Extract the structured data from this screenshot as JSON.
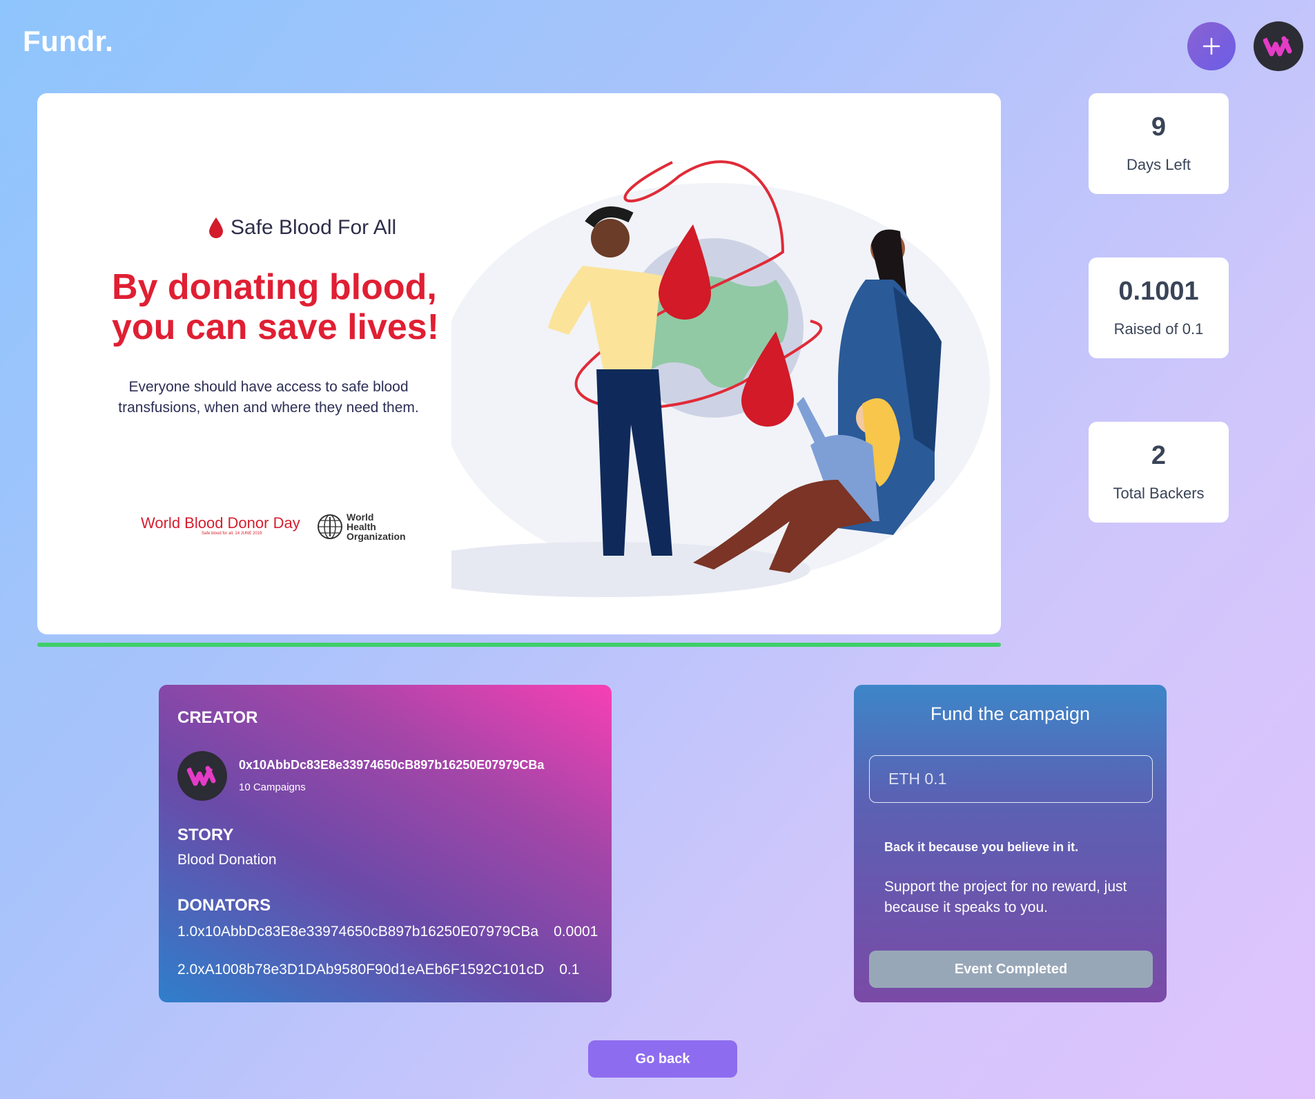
{
  "app": {
    "logo": "Fundr."
  },
  "header": {
    "add_icon": "plus-icon",
    "avatar_icon": "w-logo-icon"
  },
  "banner": {
    "tagline": "Safe Blood For All",
    "headline": "By donating blood, you can save lives!",
    "subtext": "Everyone should have access to safe blood transfusions, when and where they need them.",
    "wbdd_text": "World Blood Donor Day",
    "wbdd_sub": "Safe blood for all. 14 JUNE 2019",
    "who_text": "World Health Organization"
  },
  "progress": {
    "fraction": 1.0,
    "color": "#3ecf6a"
  },
  "stats": [
    {
      "value": "9",
      "label": "Days Left"
    },
    {
      "value": "0.1001",
      "label": "Raised of 0.1"
    },
    {
      "value": "2",
      "label": "Total Backers"
    }
  ],
  "creator": {
    "heading": "CREATOR",
    "address": "0x10AbbDc83E8e33974650cB897b16250E07979CBa",
    "campaigns": "10 Campaigns"
  },
  "story": {
    "heading": "STORY",
    "text": "Blood Donation"
  },
  "donators": {
    "heading": "DONATORS",
    "list": [
      {
        "entry": "1.0x10AbbDc83E8e33974650cB897b16250E07979CBa",
        "amount": "0.0001"
      },
      {
        "entry": "2.0xA1008b78e3D1DAb9580F90d1eAEb6F1592C101cD",
        "amount": "0.1"
      }
    ]
  },
  "fund": {
    "title": "Fund the campaign",
    "input_placeholder": "ETH 0.1",
    "tagline": "Back it because you believe in it.",
    "description": "Support the project for no reward, just because it speaks to you.",
    "button_label": "Event Completed"
  },
  "footer": {
    "go_back_label": "Go back"
  },
  "colors": {
    "accent": "#8e6cf0",
    "headline_red": "#e01f33",
    "creator_gradient_end": "#f740b4"
  }
}
